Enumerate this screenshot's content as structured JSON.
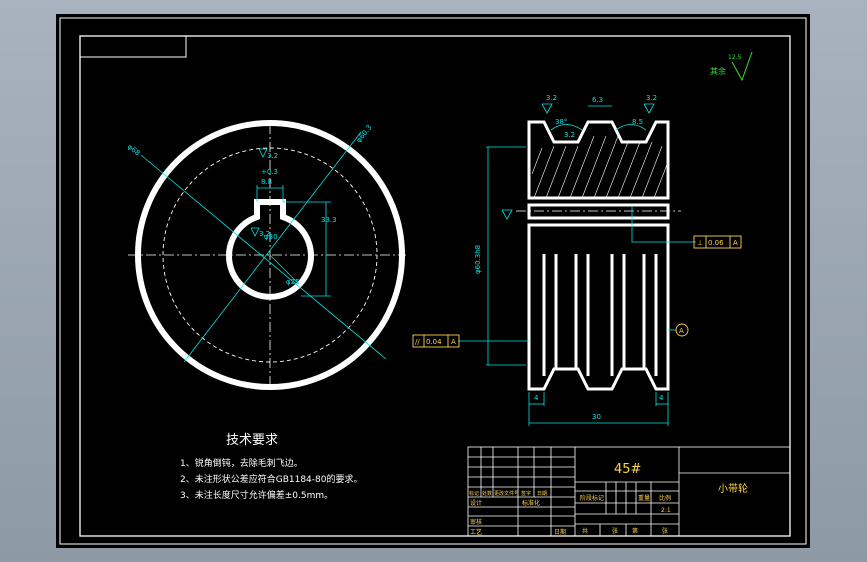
{
  "dimensions": {
    "outer_dia": "φ68",
    "pitch_dia": "φ60.3",
    "key_height": "33.3",
    "key_width": "8.8",
    "key_tol": "+0.3",
    "bore": "φ25",
    "key_dia": "φ30",
    "rough_1": "3.2",
    "rough_2": "3.2",
    "rough_3": "3.2",
    "rough_bore": "3.2",
    "roughness_pref": "其余",
    "rough_other": "12.5",
    "groove_angle": "38°",
    "groove_top_w": "6.3",
    "groove_depth": "3.2",
    "groove_pitch_w": "8.5",
    "tol_perp": "0.06",
    "tol_par": "0.04",
    "datum": "A",
    "side_height": "φ60.3h8",
    "edge_left": "4",
    "edge_right": "4",
    "total_width": "30"
  },
  "tech_req": {
    "title": "技术要求",
    "items": [
      "1、锐角倒钝，去除毛刺飞边。",
      "2、未注形状公差应符合GB1184-80的要求。",
      "3、未注长度尺寸允许偏差±0.5mm。"
    ]
  },
  "title_block": {
    "material": "45#",
    "part_name": "小带轮",
    "rev_headers": [
      "标记",
      "处数",
      "更改文件号",
      "签字",
      "日期"
    ],
    "rev_labels": [
      "设计",
      "审核",
      "工艺",
      "标准化",
      "日期"
    ],
    "stage_headers": [
      "阶段标记",
      "重量",
      "比例"
    ],
    "scale": "2:1",
    "sheet_labels": [
      "共",
      "张",
      "第",
      "张"
    ]
  }
}
